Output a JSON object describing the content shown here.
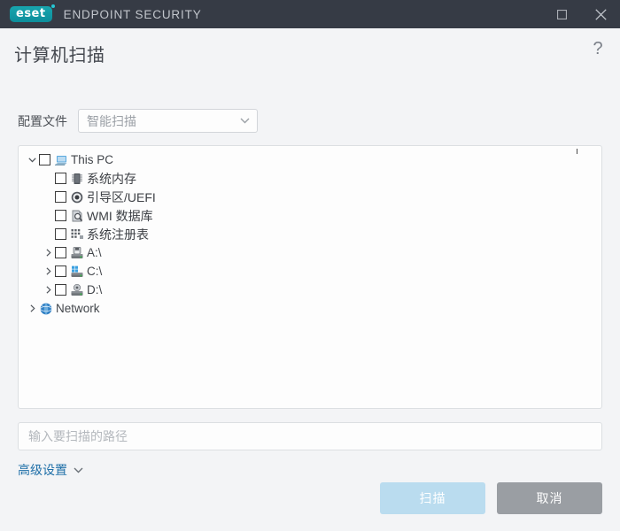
{
  "titlebar": {
    "logo_text": "eset",
    "product_name": "ENDPOINT SECURITY",
    "maximize_label": "maximize",
    "close_label": "close",
    "background_color": "#363b45",
    "logo_color": "#0e9aa7"
  },
  "header": {
    "title": "计算机扫描",
    "help_label": "?"
  },
  "profile": {
    "label": "配置文件",
    "selected": "智能扫描",
    "options": [
      "智能扫描"
    ]
  },
  "tree": {
    "items": [
      {
        "label": "This PC",
        "icon": "computer-icon",
        "indent": 0,
        "twisty": "down",
        "checkbox": true,
        "checked": false,
        "latin": true
      },
      {
        "label": "系统内存",
        "icon": "memory-icon",
        "indent": 1,
        "twisty": "none",
        "checkbox": true,
        "checked": false,
        "latin": false
      },
      {
        "label": "引导区/UEFI",
        "icon": "disc-icon",
        "indent": 1,
        "twisty": "none",
        "checkbox": true,
        "checked": false,
        "latin": false
      },
      {
        "label": "WMI 数据库",
        "icon": "wmi-icon",
        "indent": 1,
        "twisty": "none",
        "checkbox": true,
        "checked": false,
        "latin": false
      },
      {
        "label": "系统注册表",
        "icon": "registry-icon",
        "indent": 1,
        "twisty": "none",
        "checkbox": true,
        "checked": false,
        "latin": false
      },
      {
        "label": "A:\\",
        "icon": "floppy-drive-icon",
        "indent": 1,
        "twisty": "right",
        "checkbox": true,
        "checked": false,
        "latin": true
      },
      {
        "label": "C:\\",
        "icon": "hard-drive-icon",
        "indent": 1,
        "twisty": "right",
        "checkbox": true,
        "checked": false,
        "latin": true
      },
      {
        "label": "D:\\",
        "icon": "optical-drive-icon",
        "indent": 1,
        "twisty": "right",
        "checkbox": true,
        "checked": false,
        "latin": true
      },
      {
        "label": "Network",
        "icon": "globe-icon",
        "indent": 0,
        "twisty": "right",
        "checkbox": false,
        "checked": false,
        "latin": true
      }
    ]
  },
  "path": {
    "value": "",
    "placeholder": "输入要扫描的路径"
  },
  "advanced": {
    "label": "高级设置",
    "link_color": "#1f6fa8"
  },
  "footer": {
    "scan_label": "扫描",
    "cancel_label": "取消",
    "scan_color": "#badcef",
    "cancel_color": "#9a9ea3"
  }
}
